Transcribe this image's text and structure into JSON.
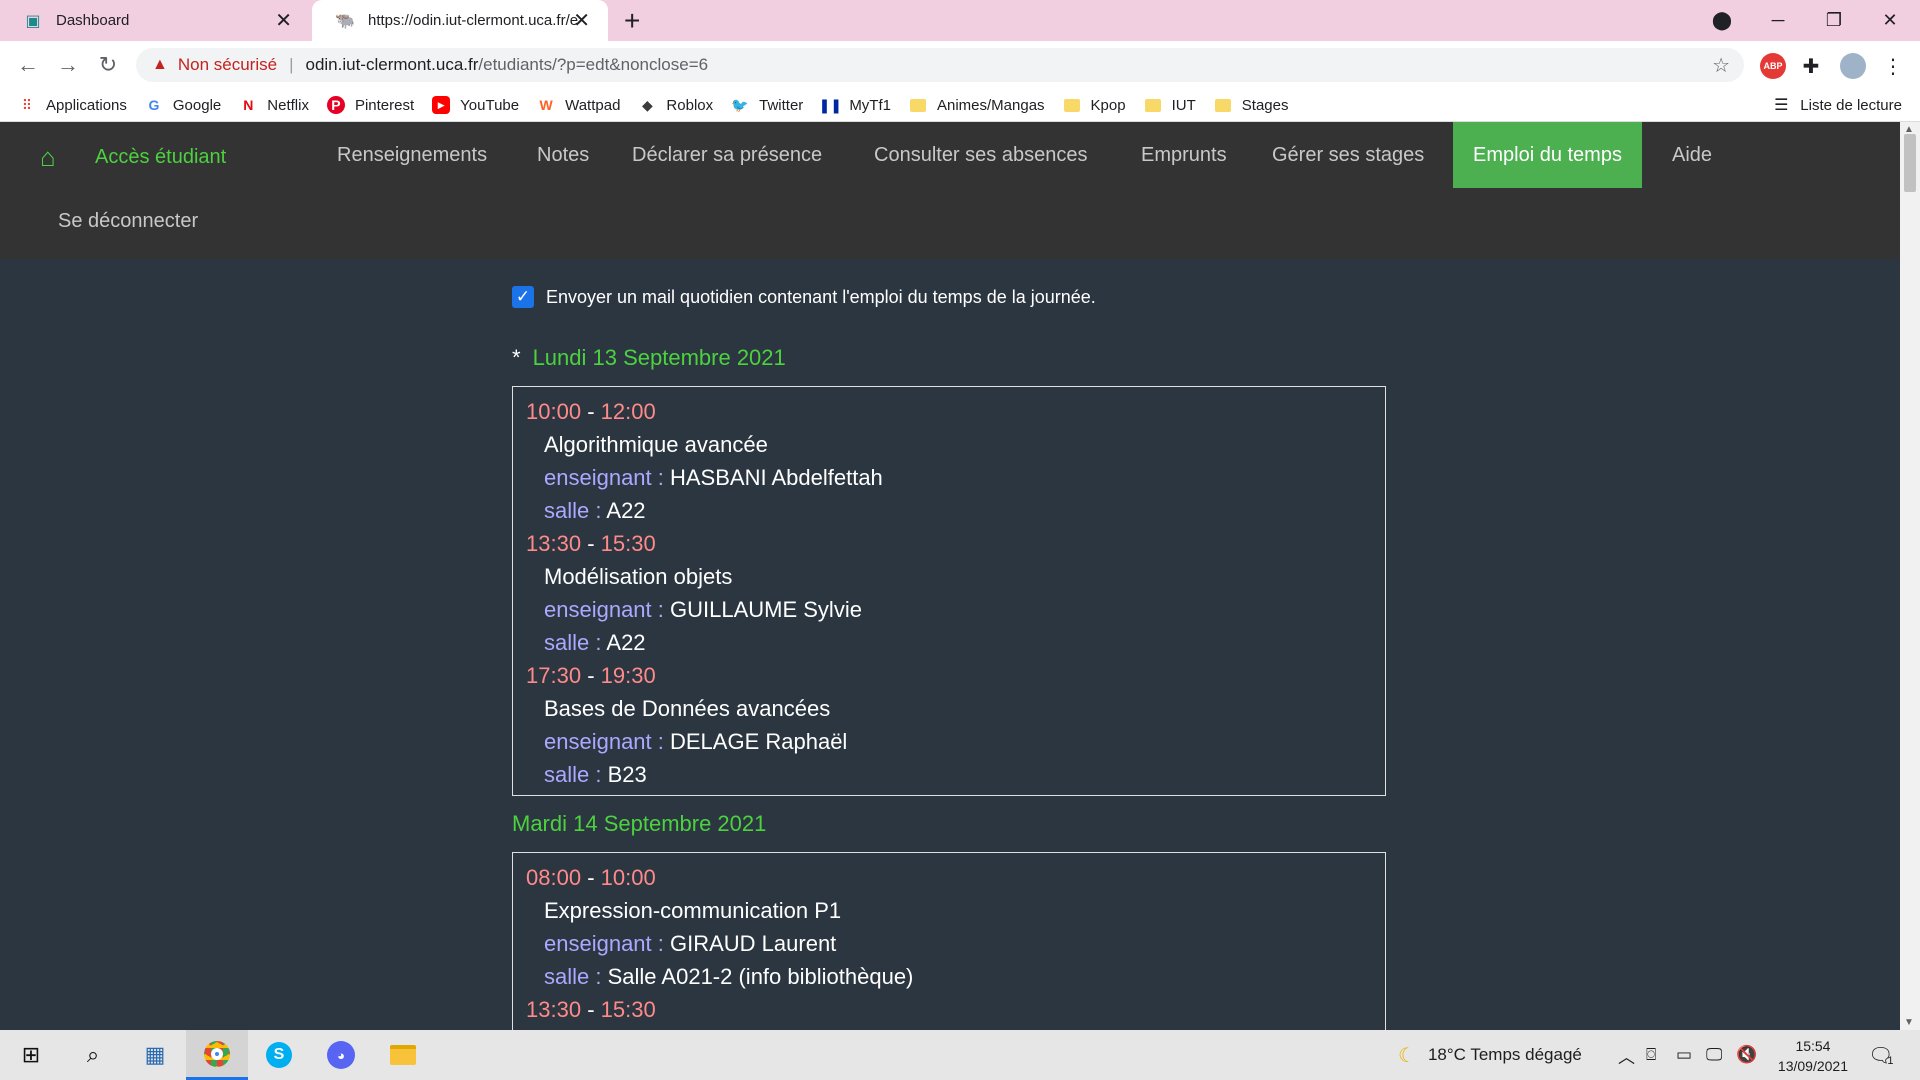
{
  "browser": {
    "tabs": [
      {
        "title": "Dashboard",
        "active": false
      },
      {
        "title": "https://odin.iut-clermont.uca.fr/e",
        "active": true
      }
    ],
    "address": {
      "security_label": "Non sécurisé",
      "host": "odin.iut-clermont.uca.fr",
      "path": "/etudiants/?p=edt&nonclose=6"
    },
    "bookmarks": [
      {
        "label": "Applications",
        "icon": "apps-grid-icon"
      },
      {
        "label": "Google",
        "icon": "google-icon"
      },
      {
        "label": "Netflix",
        "icon": "netflix-icon"
      },
      {
        "label": "Pinterest",
        "icon": "pinterest-icon"
      },
      {
        "label": "YouTube",
        "icon": "youtube-icon"
      },
      {
        "label": "Wattpad",
        "icon": "wattpad-icon"
      },
      {
        "label": "Roblox",
        "icon": "roblox-icon"
      },
      {
        "label": "Twitter",
        "icon": "twitter-icon"
      },
      {
        "label": "MyTf1",
        "icon": "mytf1-icon"
      },
      {
        "label": "Animes/Mangas",
        "icon": "folder-icon"
      },
      {
        "label": "Kpop",
        "icon": "folder-icon"
      },
      {
        "label": "IUT",
        "icon": "folder-icon"
      },
      {
        "label": "Stages",
        "icon": "folder-icon"
      }
    ],
    "reading_list": "Liste de lecture"
  },
  "site": {
    "home_label": "Accès étudiant",
    "nav": [
      "Renseignements",
      "Notes",
      "Déclarer sa présence",
      "Consulter ses absences",
      "Emprunts",
      "Gérer ses stages",
      "Emploi du temps",
      "Aide"
    ],
    "active_nav": "Emploi du temps",
    "logout": "Se déconnecter",
    "mail_option": "Envoyer un mail quotidien contenant l'emploi du temps de la journée.",
    "mail_checked": true
  },
  "labels": {
    "teacher": "enseignant :",
    "room": "salle :",
    "star": "*",
    "dash": "-"
  },
  "days": [
    {
      "date": "Lundi 13 Septembre 2021",
      "courses": [
        {
          "start": "10:00",
          "end": "12:00",
          "name": "Algorithmique avancée",
          "teacher": "HASBANI Abdelfettah",
          "room": "A22"
        },
        {
          "start": "13:30",
          "end": "15:30",
          "name": "Modélisation objets",
          "teacher": "GUILLAUME Sylvie",
          "room": "A22"
        },
        {
          "start": "17:30",
          "end": "19:30",
          "name": "Bases de Données avancées",
          "teacher": "DELAGE Raphaël",
          "room": "B23"
        }
      ]
    },
    {
      "date": "Mardi 14 Septembre 2021",
      "courses": [
        {
          "start": "08:00",
          "end": "10:00",
          "name": "Expression-communication P1",
          "teacher": "GIRAUD Laurent",
          "room": "Salle A021-2 (info bibliothèque)"
        },
        {
          "start": "13:30",
          "end": "15:30"
        }
      ]
    }
  ],
  "taskbar": {
    "weather": "18°C Temps dégagé",
    "time": "15:54",
    "date": "13/09/2021",
    "notifications": "1"
  }
}
